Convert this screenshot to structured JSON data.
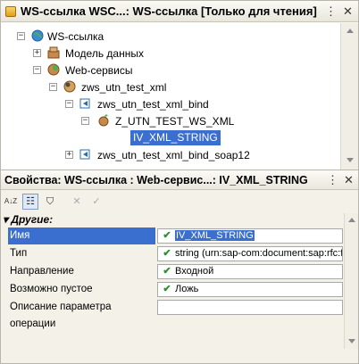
{
  "window": {
    "title": "WS-ссылка WSC...: WS-ссылка [Только для чтения]",
    "buttons": {
      "close": "✕",
      "menu": "⋮"
    }
  },
  "tree": {
    "nodes": [
      {
        "label": "WS-ссылка",
        "expander": "−"
      },
      {
        "label": "Модель данных",
        "expander": "+"
      },
      {
        "label": "Web-сервисы",
        "expander": "−"
      },
      {
        "label": "zws_utn_test_xml",
        "expander": "−"
      },
      {
        "label": "zws_utn_test_xml_bind",
        "expander": "−"
      },
      {
        "label": "Z_UTN_TEST_WS_XML",
        "expander": "−"
      },
      {
        "label": "IV_XML_STRING",
        "expander": ""
      },
      {
        "label": "zws_utn_test_xml_bind_soap12",
        "expander": "+"
      }
    ]
  },
  "properties": {
    "title": "Свойства: WS-ссылка : Web-сервис...: IV_XML_STRING",
    "toolbar": {
      "sort_az": "A↓Z",
      "categories": "☷",
      "filter": "⛉",
      "close": "✕",
      "check": "✓"
    },
    "group": "▾ Другие:",
    "rows": [
      {
        "name": "Имя",
        "value": "IV_XML_STRING",
        "checked": true
      },
      {
        "name": "Тип",
        "value": "string (urn:sap-com:document:sap:rfc:fu",
        "checked": true
      },
      {
        "name": "Направление",
        "value": "Входной",
        "checked": true
      },
      {
        "name": "Возможно пустое",
        "value": "Ложь",
        "checked": true
      },
      {
        "name": "Описание параметра операции",
        "value": "",
        "checked": false
      }
    ],
    "check_mark": "✔"
  }
}
